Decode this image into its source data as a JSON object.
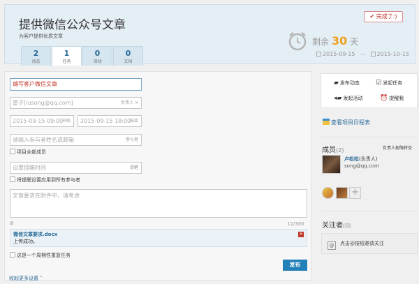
{
  "header": {
    "title": "提供微信公众号文章",
    "subtitle": "为客户提供优质文章",
    "done_label": "✔ 完成了:)",
    "remain_prefix": "剩余",
    "remain_days": "30",
    "remain_suffix": "天",
    "start_date": "2015-09-15",
    "date_sep": "—",
    "end_date": "2015-10-15"
  },
  "tabs": [
    {
      "count": "2",
      "label": "动态"
    },
    {
      "count": "1",
      "label": "任务"
    },
    {
      "count": "0",
      "label": "活动"
    },
    {
      "count": "0",
      "label": "文档"
    }
  ],
  "form": {
    "title_value": "编写客户微信文章",
    "owner_value": "雷子[lusong@qq.com]",
    "owner_suffix": "负责人 ✕",
    "start_value": "2015-09-15 09:00",
    "start_suffix": "开始",
    "end_value": "2015-09-15 18:00",
    "end_suffix": "结束",
    "participants_placeholder": "请输入参与者姓名或邮箱",
    "participants_suffix": "参与者",
    "all_members_label": "项目全部成员",
    "reminder_placeholder": "设置提醒时间",
    "reminder_suffix": "提醒",
    "apply_reminder_label": "将提醒设置应用到所有参与者",
    "desc_placeholder": "文章要求在附件中，请考虑",
    "counter": "12/300",
    "attachment_name": "微信文章要求.docx",
    "attachment_status": "上传成功。",
    "repeat_label": "这是一个周期性重复任务",
    "publish_label": "发布",
    "more_settings_label": "收起更多设置 ˄"
  },
  "sidebar": {
    "actions": [
      {
        "icon": "post-icon",
        "label": "发布动态"
      },
      {
        "icon": "task-icon",
        "label": "发起任务"
      },
      {
        "icon": "event-icon",
        "label": "发起活动"
      },
      {
        "icon": "alarm-icon",
        "label": "提醒我"
      }
    ],
    "schedule_label": "查看项目日程表",
    "members_title": "成员",
    "members_count": "(2)",
    "permission_label": "负责人权限转交",
    "member_name": "卢松松",
    "member_role": "(负责人)",
    "member_email": "song@qq.com",
    "followers_title": "关注者",
    "followers_count": "(0)",
    "invite_label": "点击@按钮邀请关注"
  }
}
